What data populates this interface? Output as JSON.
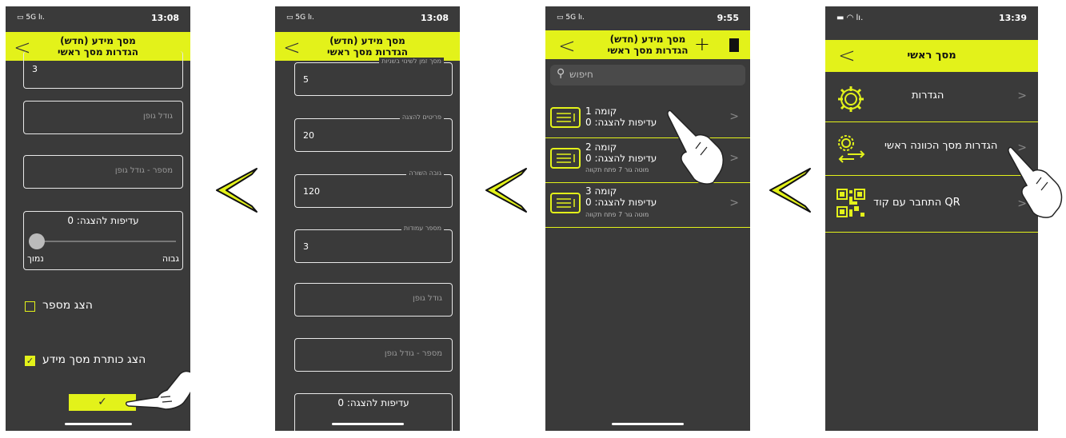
{
  "screen4": {
    "status": {
      "carrier": "5G",
      "time": "13:08"
    },
    "header": {
      "title_line1": "מסך מידע (חדש)",
      "title_line2": "הגדרות מסך ראשי"
    },
    "fields": [
      {
        "value": "3"
      },
      {
        "placeholder": "גודל גופן"
      },
      {
        "placeholder": "מספר - גודל גופן"
      }
    ],
    "priority": {
      "label": "עדיפות להצגה: 0",
      "low": "נמוך",
      "high": "גבוה",
      "value": 0
    },
    "checkbox_show_number": {
      "label": "הצג מספר",
      "checked": false
    },
    "checkbox_show_title": {
      "label": "הצג כותרת מסך מידע",
      "checked": true
    },
    "confirm_icon": "check-icon"
  },
  "screen3": {
    "status": {
      "carrier": "5G",
      "time": "13:08"
    },
    "header": {
      "title_line1": "מסך מידע (חדש)",
      "title_line2": "הגדרות מסך ראשי"
    },
    "fields": [
      {
        "label": "מסך זמן לשינוי בשניות",
        "value": "5"
      },
      {
        "label": "פריטים להצגה",
        "value": "20"
      },
      {
        "label": "גובה השורה",
        "value": "120"
      },
      {
        "label": "מספר עמודות",
        "value": "3"
      },
      {
        "placeholder": "גודל גופן"
      },
      {
        "placeholder": "מספר - גודל גופן"
      }
    ],
    "priority_label": "עדיפות להצגה: 0"
  },
  "screen2": {
    "status": {
      "carrier": "5G",
      "time": "9:55"
    },
    "header": {
      "title_line1": "מסך מידע (חדש)",
      "title_line2": "הגדרות מסך ראשי"
    },
    "search_placeholder": "חיפוש",
    "items": [
      {
        "title": "קומה 1",
        "subtitle": "עדיפות להצגה: 0",
        "note": ""
      },
      {
        "title": "קומה 2",
        "subtitle": "עדיפות להצגה: 0",
        "note": "מוטה גור 7 פתח תקווה"
      },
      {
        "title": "קומה 3",
        "subtitle": "עדיפות להצגה: 0",
        "note": "מוטה גור 7 פתח תקווה"
      }
    ]
  },
  "screen1": {
    "status": {
      "time": "13:39"
    },
    "header": {
      "title": "מסך ראשי"
    },
    "menu": [
      {
        "label": "הגדרות",
        "icon": "gear-icon"
      },
      {
        "label": "הגדרות מסך הכוונה ראשי",
        "icon": "gear-arrows-icon"
      },
      {
        "label": "התחבר עם קוד QR",
        "icon": "qr-code-icon"
      }
    ]
  },
  "colors": {
    "accent": "#e3f21a",
    "background": "#3a3a3a"
  }
}
